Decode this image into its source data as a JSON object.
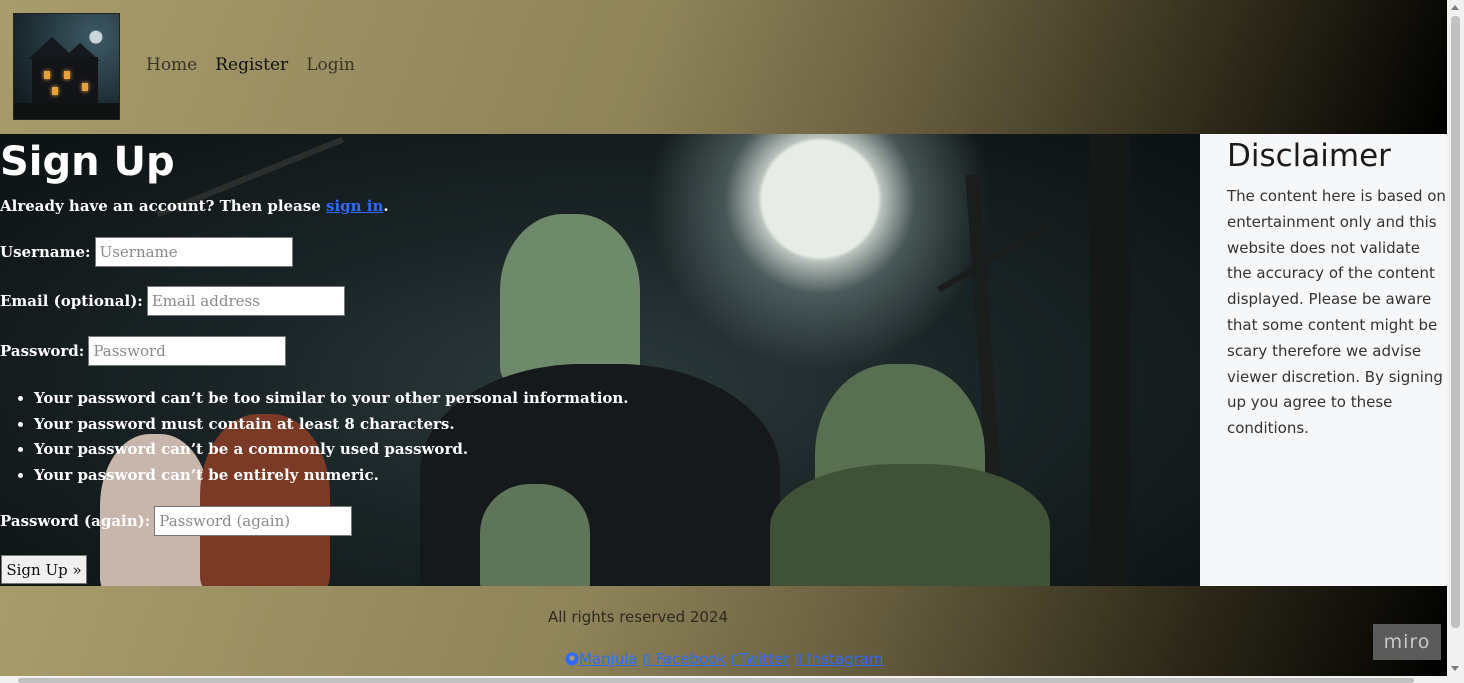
{
  "nav": {
    "home": "Home",
    "register": "Register",
    "login": "Login"
  },
  "signup": {
    "title": "Sign Up",
    "already_prefix": "Already have an account? Then please ",
    "sign_in_link": "sign in",
    "already_suffix": ".",
    "username_label": "Username:",
    "username_placeholder": "Username",
    "email_label": "Email (optional):",
    "email_placeholder": "Email address",
    "password_label": "Password:",
    "password_placeholder": "Password",
    "rules": [
      "Your password can’t be too similar to your other personal information.",
      "Your password must contain at least 8 characters.",
      "Your password can’t be a commonly used password.",
      "Your password can’t be entirely numeric."
    ],
    "password2_label": "Password (again):",
    "password2_placeholder": "Password (again)",
    "submit_label": "Sign Up »"
  },
  "disclaimer": {
    "title": "Disclaimer",
    "text": "The content here is based on entertainment only and this website does not validate the accuracy of the content displayed. Please be aware that some content might be scary therefore we advise viewer discretion. By signing up you agree to these conditions."
  },
  "footer": {
    "rights": "All rights reserved 2024",
    "links": [
      "Manjula",
      "Facebook",
      "Twitter",
      "Instagram"
    ],
    "badge": "miro"
  },
  "colors": {
    "link": "#2f6bff",
    "header_gradient_start": "#a89c6c",
    "header_gradient_end": "#000000",
    "aside_bg": "#f6f7f9"
  },
  "icons": [
    "github-icon",
    "facebook-icon",
    "twitter-icon",
    "instagram-icon"
  ]
}
